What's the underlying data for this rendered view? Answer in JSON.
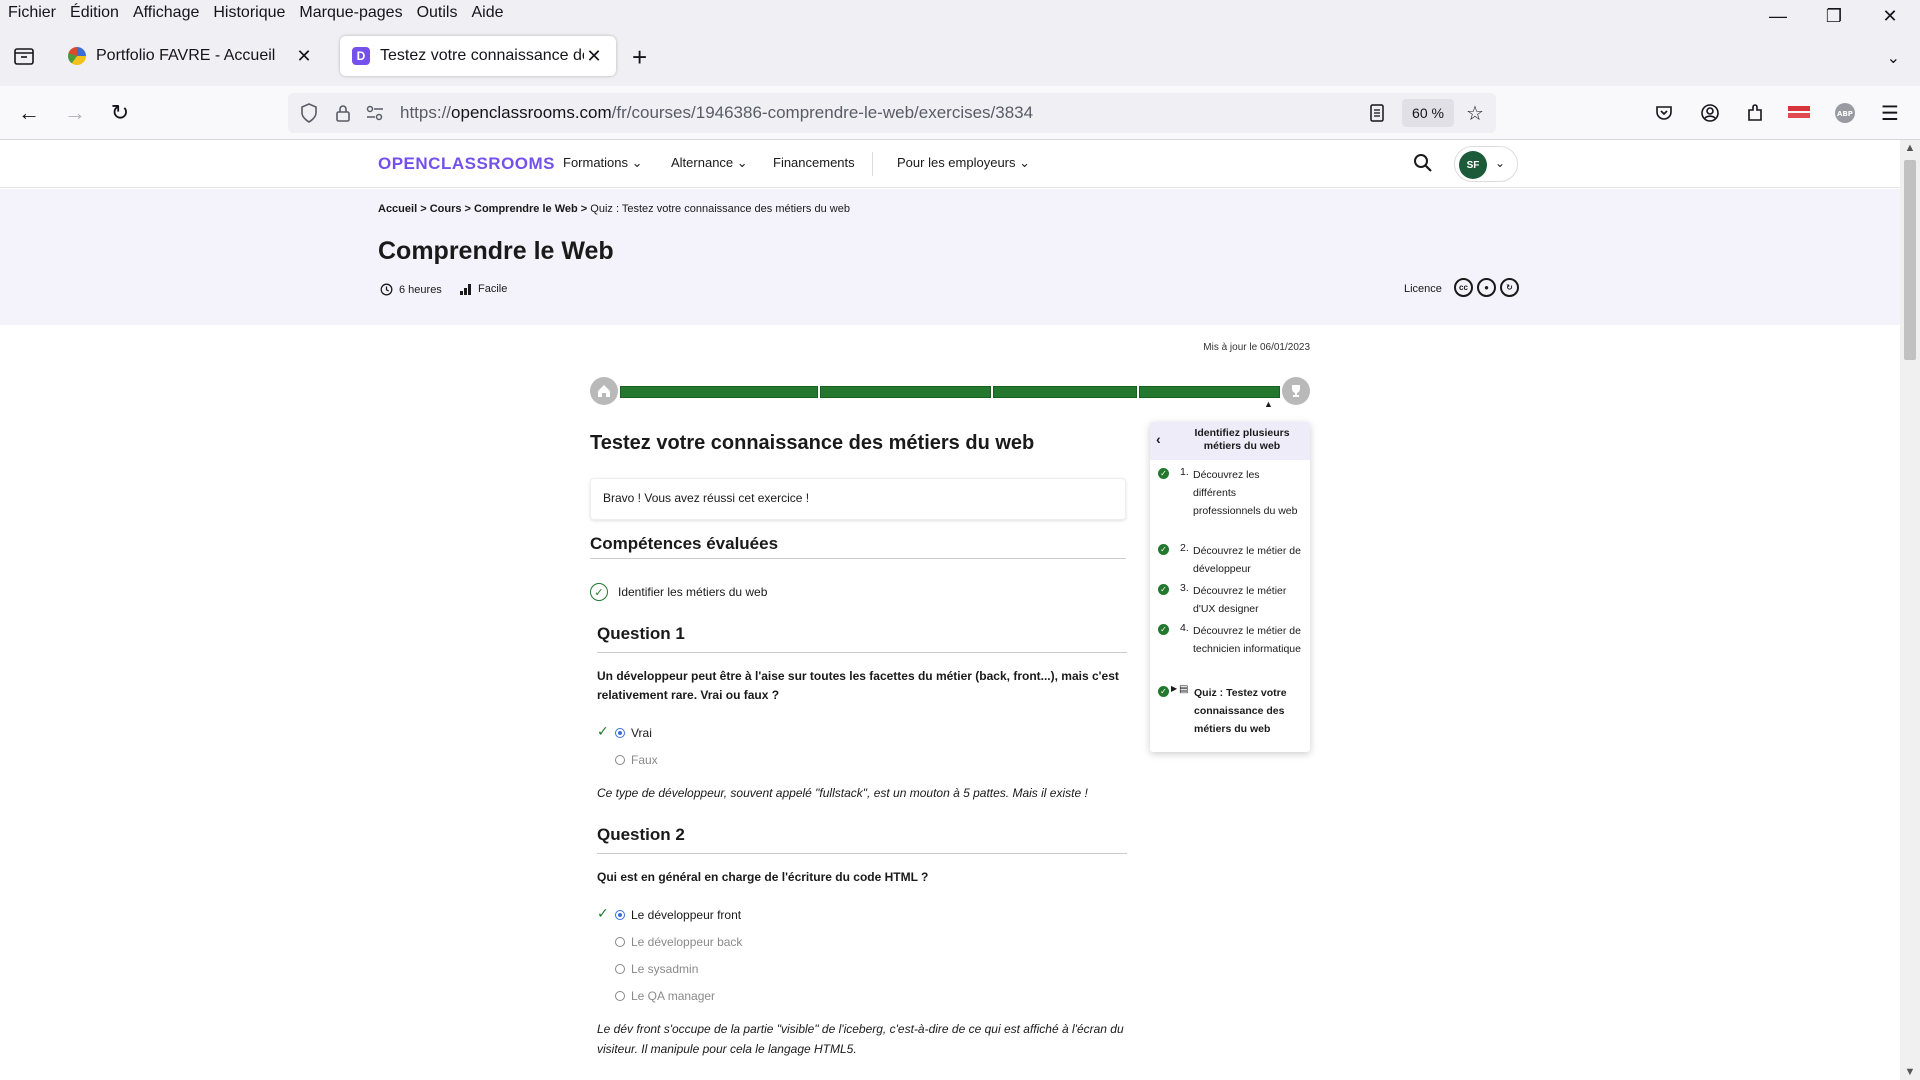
{
  "menubar": {
    "items": [
      "Fichier",
      "Édition",
      "Affichage",
      "Historique",
      "Marque-pages",
      "Outils",
      "Aide"
    ]
  },
  "tabs": [
    {
      "title": "Portfolio FAVRE - Accueil",
      "active": false,
      "icon": "colorful-globe-icon"
    },
    {
      "title": "Testez votre connaissance des métiers du web",
      "active": true,
      "icon": "openclassrooms-icon"
    }
  ],
  "urlbar": {
    "prefix": "https://",
    "host": "openclassrooms.com",
    "path": "/fr/courses/1946386-comprendre-le-web/exercises/3834",
    "zoom": "60 %"
  },
  "colors": {
    "brand": "#7451eb",
    "success": "#23782e",
    "hero_bg": "#f4f3fb"
  },
  "site_header": {
    "logo": "OPENCLASSROOMS",
    "nav": [
      "Formations",
      "Alternance",
      "Financements",
      "Pour les employeurs"
    ],
    "user_initials": "SF"
  },
  "course": {
    "breadcrumb": {
      "home": "Accueil",
      "courses": "Cours",
      "course": "Comprendre le Web",
      "current": "Quiz : Testez votre connaissance des métiers du web"
    },
    "title": "Comprendre le Web",
    "duration": "6 heures",
    "level": "Facile",
    "licence_label": "Licence",
    "updated": "Mis à jour le 06/01/2023"
  },
  "quiz": {
    "title": "Testez votre connaissance des métiers du web",
    "result": "Bravo ! Vous avez réussi cet exercice !",
    "skills_heading": "Compétences évaluées",
    "skill": "Identifier les métiers du web",
    "questions": [
      {
        "title": "Question 1",
        "text": "Un développeur peut être à l'aise sur toutes les facettes du métier (back, front...), mais c'est relativement rare. Vrai ou faux ?",
        "answers": [
          "Vrai",
          "Faux"
        ],
        "explanation": "Ce type de développeur, souvent appelé \"fullstack\", est un mouton à 5 pattes. Mais il existe !"
      },
      {
        "title": "Question 2",
        "text": "Qui est en général en charge de l'écriture du code HTML ?",
        "answers": [
          "Le développeur front",
          "Le développeur back",
          "Le sysadmin",
          "Le QA manager"
        ],
        "explanation": "Le dév front s'occupe de la partie \"visible\" de l'iceberg, c'est-à-dire de ce qui est affiché à l'écran du visiteur. Il manipule pour cela le langage HTML5."
      }
    ]
  },
  "chapters": {
    "title": "Identifiez plusieurs métiers du web",
    "items": [
      {
        "num": "1.",
        "label": "Découvrez les différents professionnels du web"
      },
      {
        "num": "2.",
        "label": "Découvrez le métier de développeur"
      },
      {
        "num": "3.",
        "label": "Découvrez le métier d'UX designer"
      },
      {
        "num": "4.",
        "label": "Découvrez le métier de technicien informatique"
      }
    ],
    "current": "Quiz : Testez votre connaissance des métiers du web"
  }
}
